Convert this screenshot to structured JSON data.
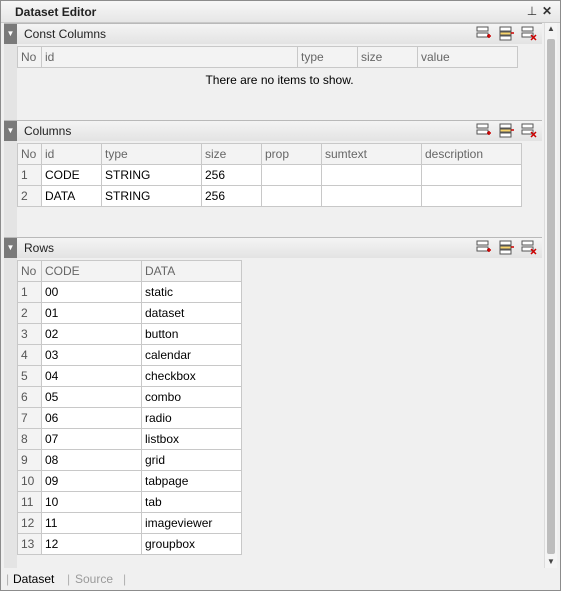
{
  "window": {
    "title": "Dataset Editor",
    "pin_icon": "pin-icon",
    "close_icon": "close-icon"
  },
  "icons": {
    "add_row": "add-row-icon",
    "insert_row": "insert-row-icon",
    "delete_row": "delete-row-icon"
  },
  "const_columns": {
    "title": "Const Columns",
    "headers": [
      "No",
      "id",
      "type",
      "size",
      "value"
    ],
    "empty_message": "There are no items to show."
  },
  "columns": {
    "title": "Columns",
    "headers": [
      "No",
      "id",
      "type",
      "size",
      "prop",
      "sumtext",
      "description"
    ],
    "rows": [
      [
        "1",
        "CODE",
        "STRING",
        "256",
        "",
        "",
        ""
      ],
      [
        "2",
        "DATA",
        "STRING",
        "256",
        "",
        "",
        ""
      ]
    ]
  },
  "rows": {
    "title": "Rows",
    "headers": [
      "No",
      "CODE",
      "DATA"
    ],
    "rows": [
      [
        "1",
        "00",
        "static"
      ],
      [
        "2",
        "01",
        "dataset"
      ],
      [
        "3",
        "02",
        "button"
      ],
      [
        "4",
        "03",
        "calendar"
      ],
      [
        "5",
        "04",
        "checkbox"
      ],
      [
        "6",
        "05",
        "combo"
      ],
      [
        "7",
        "06",
        "radio"
      ],
      [
        "8",
        "07",
        "listbox"
      ],
      [
        "9",
        "08",
        "grid"
      ],
      [
        "10",
        "09",
        "tabpage"
      ],
      [
        "11",
        "10",
        "tab"
      ],
      [
        "12",
        "11",
        "imageviewer"
      ],
      [
        "13",
        "12",
        "groupbox"
      ]
    ]
  },
  "tabs": {
    "dataset": "Dataset",
    "source": "Source",
    "separator": "|"
  }
}
